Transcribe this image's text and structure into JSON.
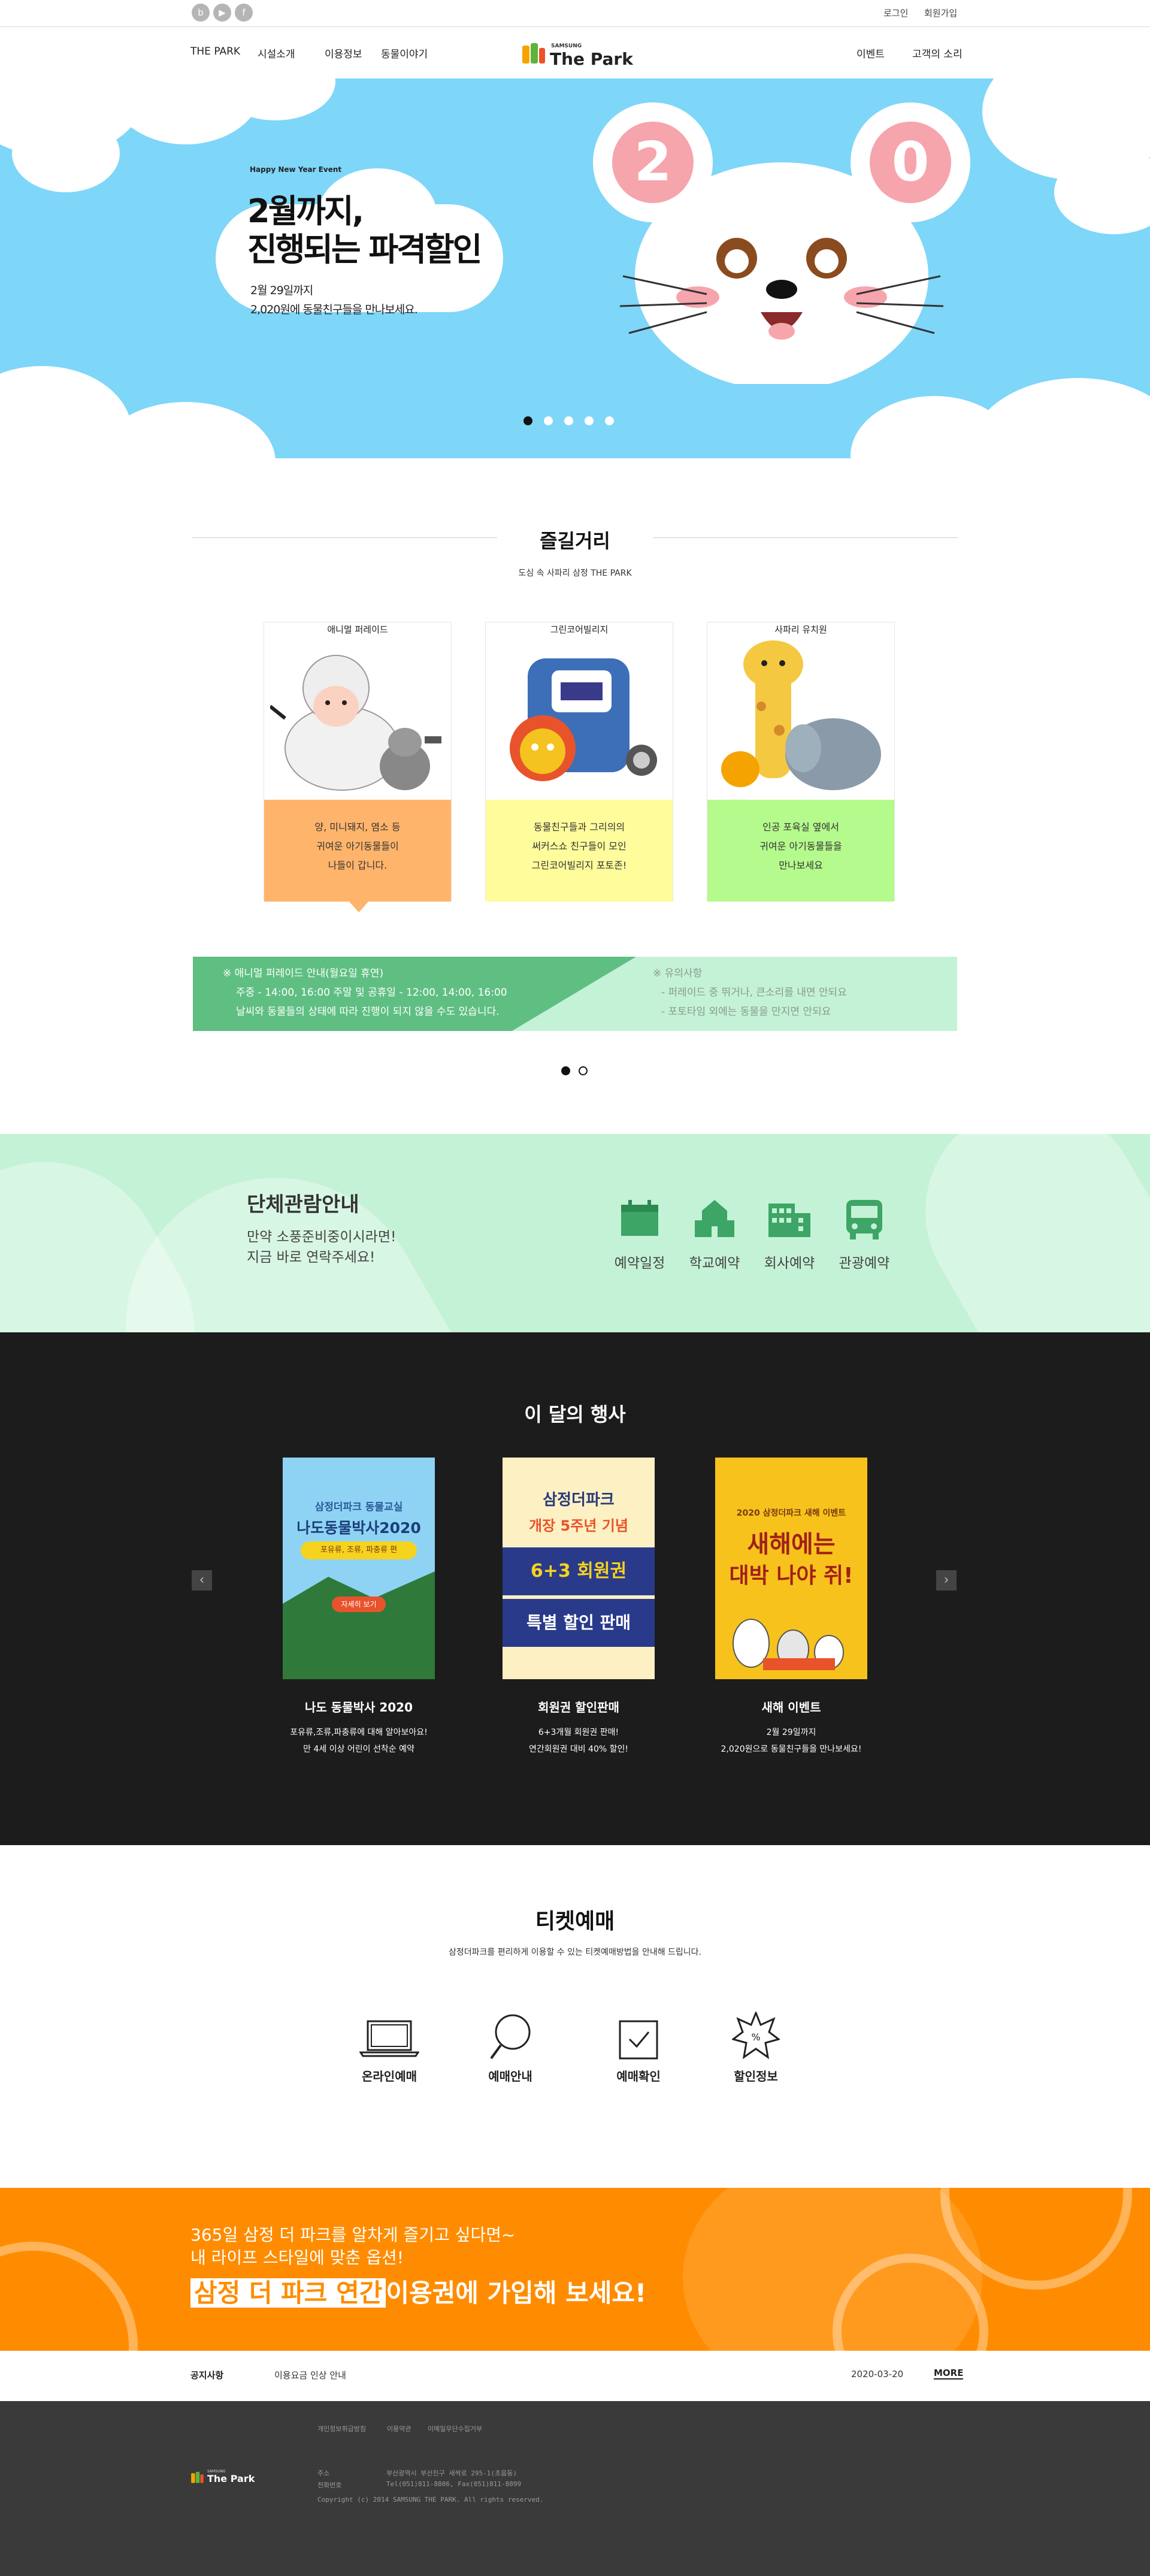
{
  "topbar": {
    "social": [
      "blog-icon",
      "youtube-icon",
      "facebook-icon"
    ],
    "login": "로그인",
    "join": "회원가입"
  },
  "header": {
    "nav_left": [
      "THE PARK",
      "시설소개",
      "이용정보",
      "동물이야기"
    ],
    "logo_top": "SAMSUNG",
    "logo_main": "The Park",
    "nav_right": [
      "이벤트",
      "고객의 소리"
    ]
  },
  "hero": {
    "eyebrow": "Happy New Year Event",
    "title_line1": "2월까지,",
    "title_line2_a": "진행되는 ",
    "title_line2_b": "파격할인",
    "desc_line1": "2월 29일까지",
    "desc_line2": "2,020원에 동물친구들을 만나보세요.",
    "slides": 5,
    "active_slide": 1,
    "colors": {
      "sky": "#7ed6f9"
    }
  },
  "fun": {
    "title": "즐길거리",
    "subtitle": "도심 속 사파리 삼정 THE PARK",
    "cards": [
      {
        "label": "애니멀 퍼레이드",
        "lines": [
          "양, 미니돼지, 염소 등",
          "귀여운 아기동물들이",
          "나들이 갑니다."
        ],
        "color": "#ffb46b"
      },
      {
        "label": "그린코어빌리지",
        "lines": [
          "동물친구들과 그리의의",
          "써커스쇼 친구들이 모인",
          "그린코어빌리지 포토존!"
        ],
        "color": "#fffc9c"
      },
      {
        "label": "사파리 유치원",
        "lines": [
          "인공 포육실 옆에서",
          "귀여운 아기동물들을",
          "만나보세요"
        ],
        "color": "#b4fa8c"
      }
    ],
    "info_left": [
      "※ 애니멀 퍼레이드 안내(월요일 휴연)",
      "주중 - 14:00, 16:00   주말 및 공휴일 - 12:00, 14:00, 16:00",
      "날씨와 동물들의 상태에 따라 진행이 되지 않을 수도 있습니다."
    ],
    "info_right": [
      "※ 유의사항",
      "- 퍼레이드 중 뛰거나, 큰소리를 내면 안되요",
      "- 포토타임 외에는 동물을 만지면 안되요"
    ],
    "pager": 2,
    "pager_active": 1
  },
  "group": {
    "title": "단체관람안내",
    "desc_line1": "만약 소풍준비중이시라면!",
    "desc_line2": "지금 바로 연락주세요!",
    "items": [
      {
        "label": "예약일정",
        "icon": "calendar-icon"
      },
      {
        "label": "학교예약",
        "icon": "school-icon"
      },
      {
        "label": "회사예약",
        "icon": "building-icon"
      },
      {
        "label": "관광예약",
        "icon": "bus-icon"
      }
    ],
    "accent": "#3da566"
  },
  "events": {
    "title": "이 달의 행사",
    "prev": "‹",
    "next": "›",
    "items": [
      {
        "title": "나도 동물박사 2020",
        "desc1": "포유류,조류,파충류에 대해 알아보아요!",
        "desc2": "만 4세 이상 어린이 선착순 예약",
        "poster_top": "삼정더파크 동물교실",
        "poster_main": "나도동물박사2020",
        "poster_sub": "포유류, 조류, 파충류 편",
        "poster_btn": "자세히 보기"
      },
      {
        "title": "회원권 할인판매",
        "desc1": "6+3개월 회원권 판매!",
        "desc2": "연간회원권 대비 40% 할인!",
        "poster_top": "삼정더파크",
        "poster_main": "개장 5주년 기념",
        "poster_sub": "6+3 회원권",
        "poster_btn": "특별 할인 판매"
      },
      {
        "title": "새해 이벤트",
        "desc1": "2월 29일까지",
        "desc2": "2,020원으로 동물친구들을 만나보세요!",
        "poster_top": "2020 삼정더파크 새해 이벤트",
        "poster_main": "새해에는",
        "poster_sub": "대박 나야 쥐!",
        "poster_btn": ""
      }
    ]
  },
  "tickets": {
    "title": "티켓예매",
    "subtitle": "삼정더파크를 편리하게 이용할 수 있는 티켓예매방법을 안내해 드립니다.",
    "items": [
      {
        "label": "온라인예매",
        "icon": "laptop-icon"
      },
      {
        "label": "예매안내",
        "icon": "magnifier-icon"
      },
      {
        "label": "예매확인",
        "icon": "checkbox-icon"
      },
      {
        "label": "할인정보",
        "icon": "discount-badge-icon"
      }
    ]
  },
  "banner": {
    "line1": "365일 삼정 더 파크를 알차게 즐기고 싶다면~",
    "line2": "내 라이프 스타일에 맞춘 옵션!",
    "highlight": "삼정 더 파크 연간",
    "rest": "이용권에 가입해 보세요!",
    "color": "#ff8c00"
  },
  "notice": {
    "label": "공지사항",
    "text": "이용요금 인상 안내",
    "date": "2020-03-20",
    "more": "MORE"
  },
  "footer": {
    "links": [
      "개인정보취급방침",
      "이용약관",
      "이메일무단수집거부"
    ],
    "logo_top": "SAMSUNG",
    "logo_main": "The Park",
    "addr_label": "주소",
    "addr": "부산광역시 부산진구 새싹로 295-1(초읍동)",
    "tel_label": "전화번호",
    "tel": "Tel(051)811-8806, Fax(051)811-8899",
    "copyright": "Copyright (c) 2014 SAMSUNG THE PARK. All rights reserved."
  }
}
